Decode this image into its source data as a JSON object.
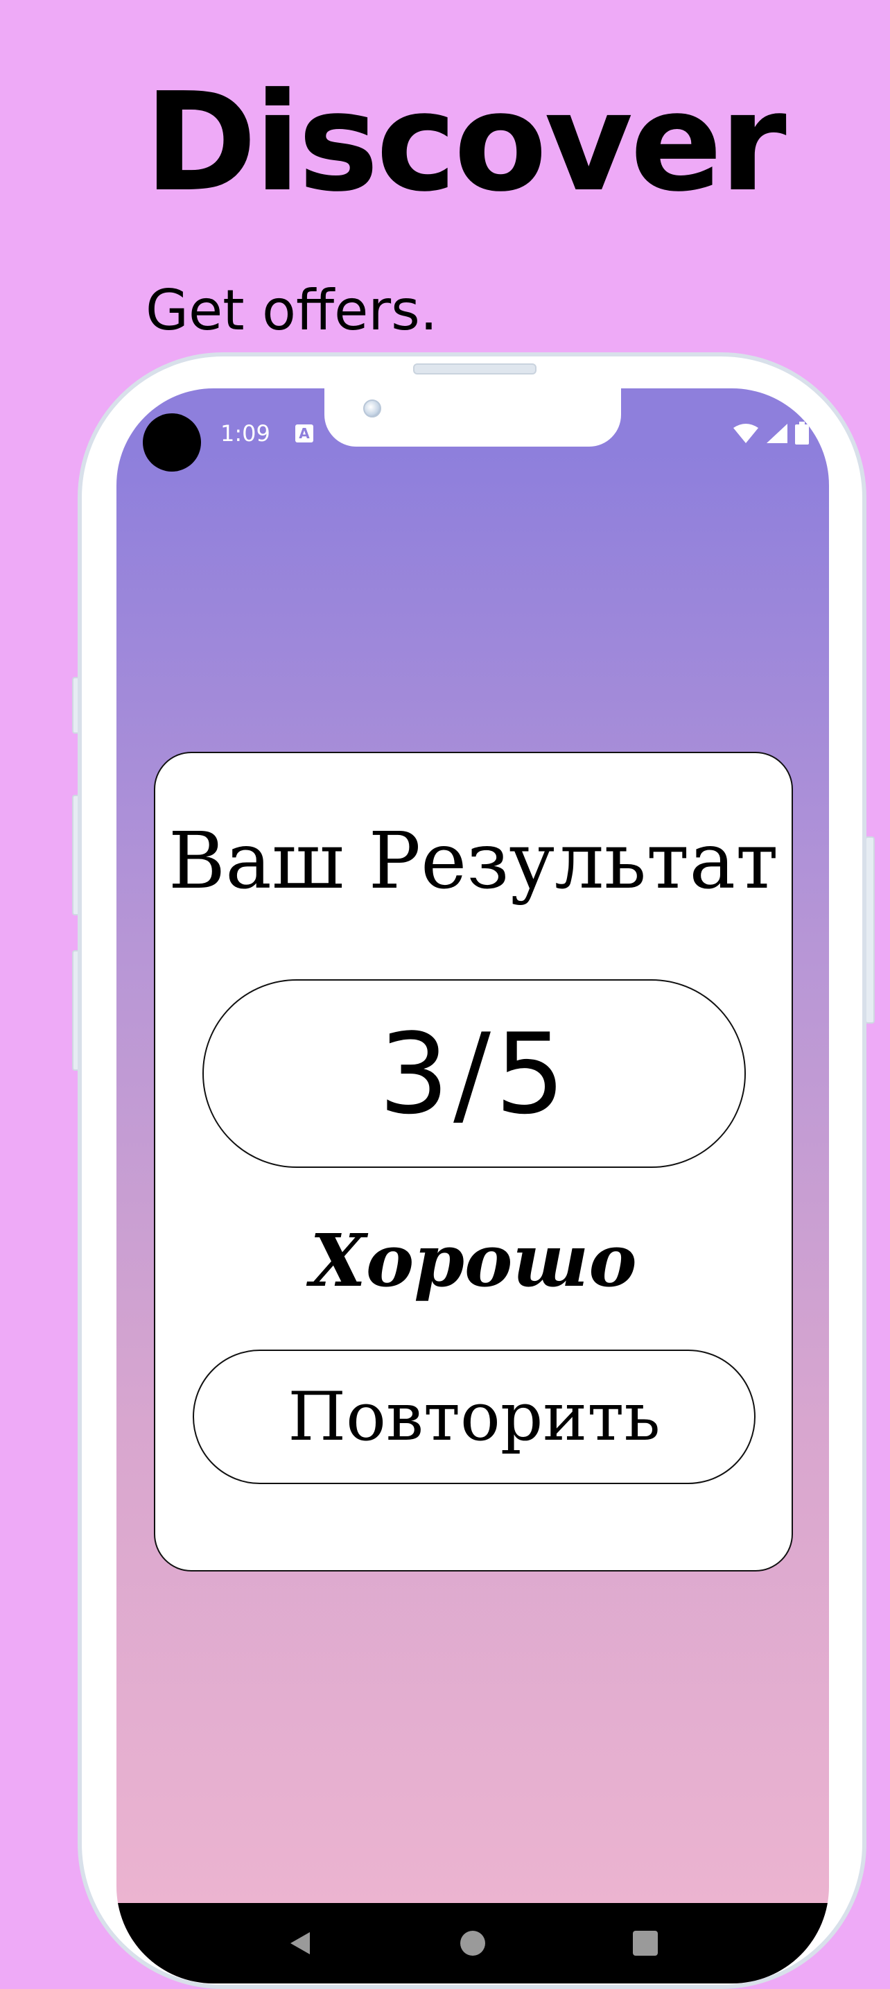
{
  "promo": {
    "headline": "Discover",
    "subline": "Get offers."
  },
  "status_bar": {
    "time": "1:09",
    "icons": [
      "a-notification-icon",
      "wifi-icon",
      "signal-icon",
      "battery-icon"
    ]
  },
  "result_card": {
    "title": "Ваш Результат",
    "score": "3/5",
    "verdict": "Хорошо",
    "retry_label": "Повторить"
  },
  "nav_bar": {
    "icons": [
      "back-icon",
      "home-icon",
      "recents-icon"
    ]
  },
  "colors": {
    "background": "#eeaaf7",
    "screen_gradient_top": "#8e7fdc",
    "screen_gradient_bottom": "#efb6d0",
    "card": "#ffffff",
    "nav_bar": "#000000"
  }
}
